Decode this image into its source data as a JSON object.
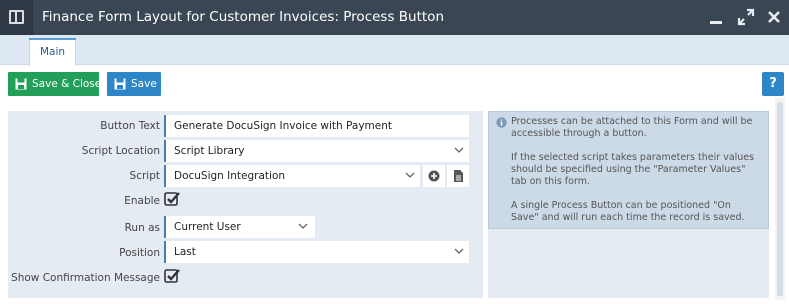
{
  "window": {
    "title": "Finance Form Layout for Customer Invoices: Process Button"
  },
  "tabs": [
    {
      "label": "Main",
      "active": true
    }
  ],
  "toolbar": {
    "save_close_label": "Save & Close",
    "save_label": "Save",
    "help_label": "?"
  },
  "form": {
    "button_text": {
      "label": "Button Text",
      "value": "Generate DocuSign Invoice with Payment"
    },
    "script_location": {
      "label": "Script Location",
      "value": "Script Library"
    },
    "script": {
      "label": "Script",
      "value": "DocuSign Integration"
    },
    "enable": {
      "label": "Enable",
      "checked": true
    },
    "run_as": {
      "label": "Run as",
      "value": "Current User"
    },
    "position": {
      "label": "Position",
      "value": "Last"
    },
    "show_confirmation": {
      "label": "Show Confirmation Message",
      "checked": true
    }
  },
  "info": {
    "paragraphs": [
      "Processes can be attached to this Form and will be accessible through a button.",
      "If the selected script takes parameters their values should be specified using the \"Parameter Values\" tab on this form.",
      "A single Process Button can be positioned \"On Save\" and will run each time the record is saved."
    ]
  },
  "colors": {
    "titlebar": "#3b4654",
    "save_close": "#22a05a",
    "save": "#2d86c7",
    "panel": "#e4ebf2",
    "info_panel": "#ccd9e6",
    "field_accent": "#4a7cb0"
  },
  "icons": {
    "app": "window-icon",
    "minimize": "minimize-icon",
    "maximize": "expand-icon",
    "close": "close-icon",
    "save_close": "save-icon",
    "save": "save-icon",
    "add": "plus-circle-icon",
    "document": "document-icon",
    "info": "info-icon"
  }
}
